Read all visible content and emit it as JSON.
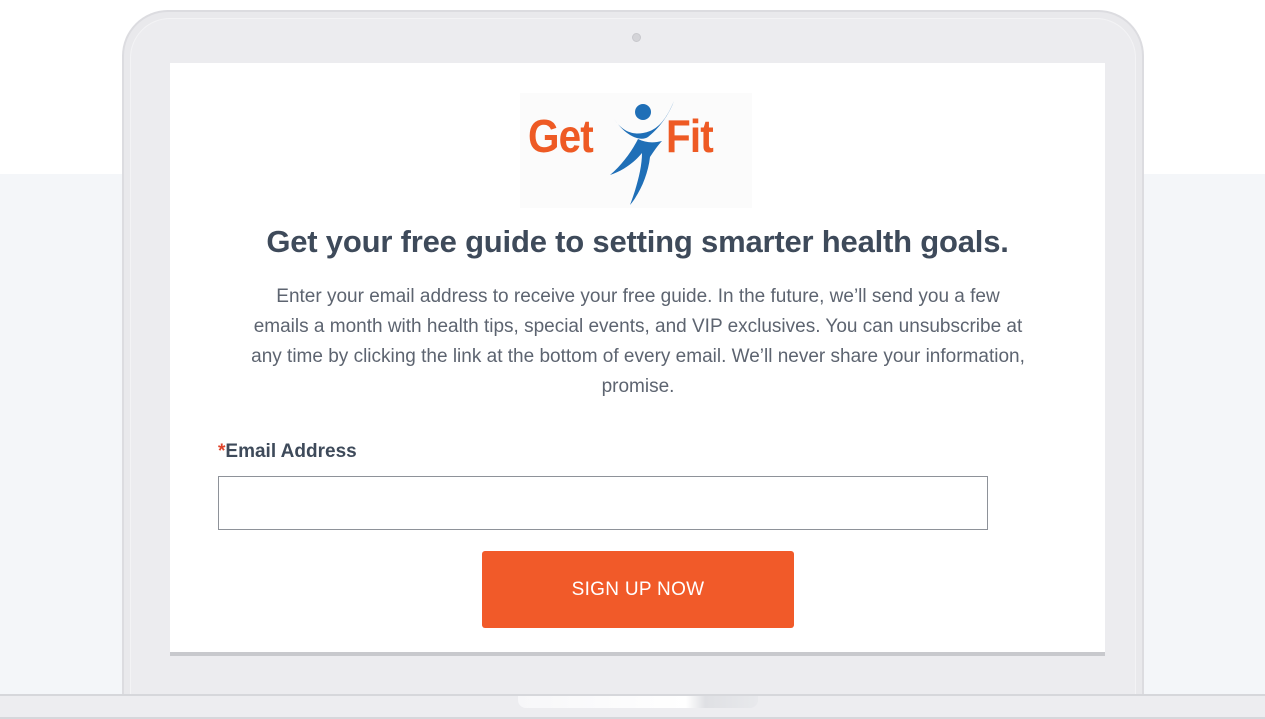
{
  "logo": {
    "word_left": "Get",
    "word_right": "Fit",
    "icon": "person-arms-raised-icon",
    "colors": {
      "text": "#ee5a24",
      "figure": "#1f6fb7"
    }
  },
  "form": {
    "headline": "Get your free guide to setting smarter health goals.",
    "description": "Enter your email address to receive your free guide. In the future, we’ll send you a few emails a month with health tips, special events, and VIP exclusives. You can unsubscribe at any time by clicking the link at the bottom of every email. We’ll never share your information, promise.",
    "email_field": {
      "required_marker": "*",
      "label": "Email Address",
      "value": "",
      "placeholder": ""
    },
    "submit_label": "SIGN UP NOW"
  },
  "colors": {
    "accent": "#f15a29",
    "heading": "#3e4a5a",
    "body_text": "#5d6470",
    "required": "#e0442b"
  }
}
